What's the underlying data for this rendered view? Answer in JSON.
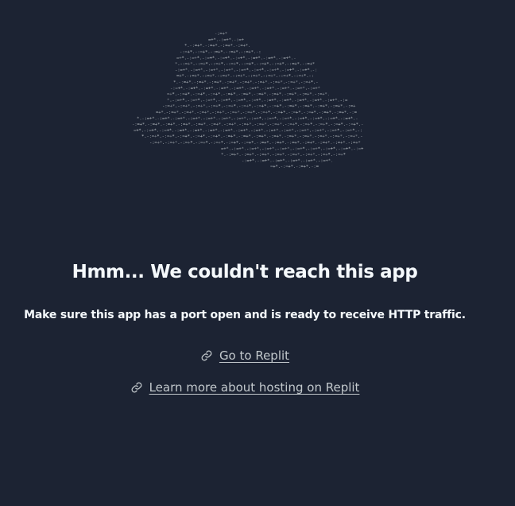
{
  "error": {
    "title": "Hmm... We couldn't reach this app",
    "message": "Make sure this app has a port open and is ready to receive HTTP traffic."
  },
  "links": [
    {
      "label": "Go to Replit",
      "icon": "link-icon"
    },
    {
      "label": "Learn more about hosting on Replit",
      "icon": "link-icon"
    }
  ],
  "colors": {
    "background": "#1c2333",
    "text": "#f5f9fc",
    "link": "#c2c8cc",
    "art": "#c2c8cc"
  }
}
